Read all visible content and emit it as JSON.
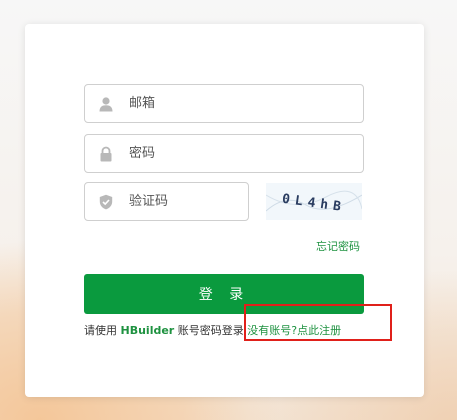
{
  "form": {
    "email_placeholder": "邮箱",
    "password_placeholder": "密码",
    "captcha_placeholder": "验证码",
    "captcha_text": "0L4hB",
    "forgot_link": "忘记密码",
    "login_button": "登 录"
  },
  "footer": {
    "prefix": "请使用 ",
    "brand": "HBuilder",
    "middle": " 账号密码登录 ",
    "register_link": "没有账号?点此注册"
  },
  "colors": {
    "accent": "#0a9a3e",
    "link": "#1e9240",
    "annotation": "#e0201a"
  }
}
